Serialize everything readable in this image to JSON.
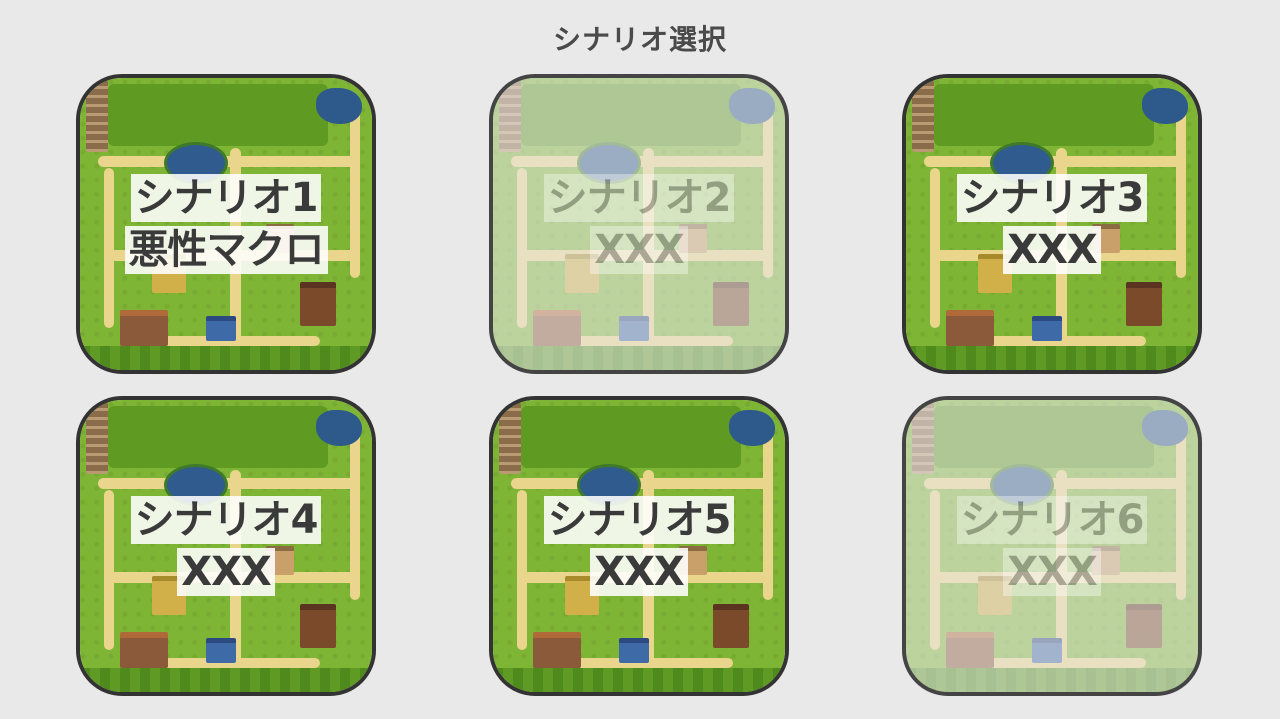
{
  "header": {
    "title": "シナリオ選択"
  },
  "scenarios": [
    {
      "line1": "シナリオ1",
      "line2": "悪性マクロ",
      "available": true
    },
    {
      "line1": "シナリオ2",
      "line2": "XXX",
      "available": false
    },
    {
      "line1": "シナリオ3",
      "line2": "XXX",
      "available": true
    },
    {
      "line1": "シナリオ4",
      "line2": "XXX",
      "available": true
    },
    {
      "line1": "シナリオ5",
      "line2": "XXX",
      "available": true
    },
    {
      "line1": "シナリオ6",
      "line2": "XXX",
      "available": false
    }
  ],
  "colors": {
    "background": "#e9e9e9",
    "card_border": "#333333",
    "grass": "#7fb535",
    "path": "#e9d58b",
    "water": "#2f5b8f",
    "label_text": "#3a3a3a"
  }
}
